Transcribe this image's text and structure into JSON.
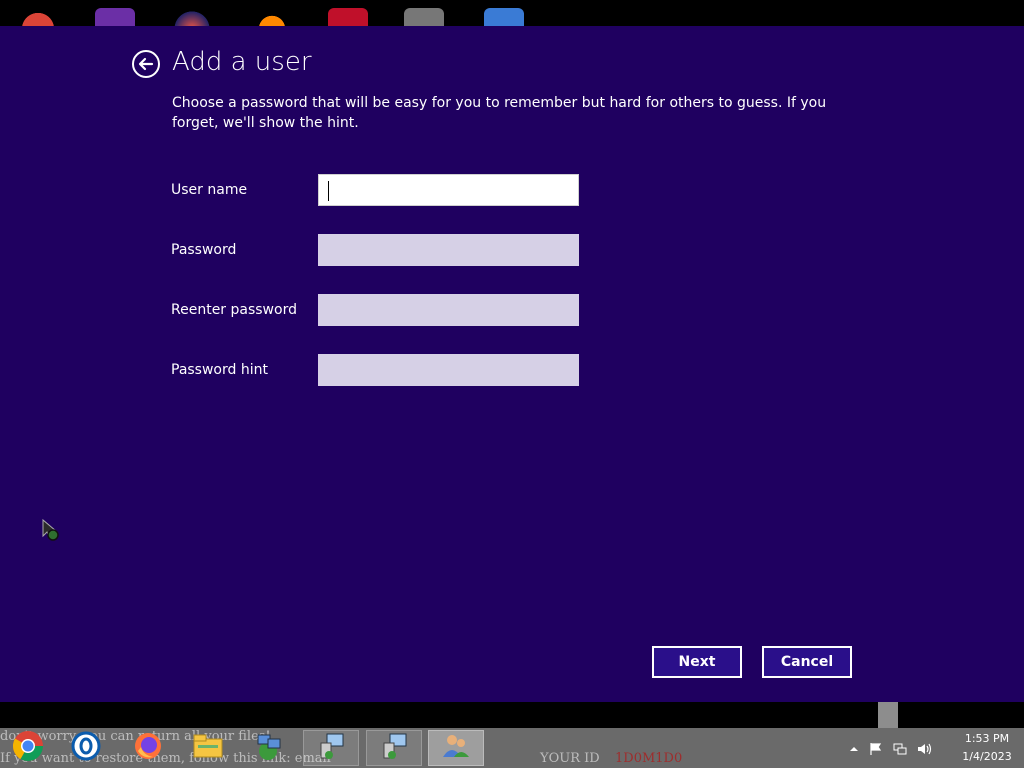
{
  "dialog": {
    "title": "Add a user",
    "subtitle": "Choose a password that will be easy for you to remember but hard for others to guess. If you forget, we'll show the hint.",
    "back_icon": "back-arrow-icon",
    "fields": [
      {
        "label": "User name",
        "value": "",
        "placeholder": "",
        "state": "focused"
      },
      {
        "label": "Password",
        "value": "",
        "placeholder": ""
      },
      {
        "label": "Reenter password",
        "value": "",
        "placeholder": ""
      },
      {
        "label": "Password hint",
        "value": "",
        "placeholder": ""
      }
    ],
    "next_label": "Next",
    "cancel_label": "Cancel"
  },
  "taskbar": {
    "pinned_icons": [
      "chrome-icon",
      "outlook-icon",
      "firefox-icon",
      "file-explorer-icon",
      "network-icon"
    ],
    "open_windows": [
      "network-setup-icon",
      "network-setup-icon",
      "user-accounts-icon"
    ],
    "tray_icons": [
      "show-hidden-icons",
      "action-center-flag-icon",
      "network-icon",
      "volume-icon"
    ],
    "clock_time": "1:53 PM",
    "clock_date": "1/4/2023"
  },
  "background_text": {
    "line1": "don't worry, you can return all your files!",
    "line2": "If you want to restore them, follow this link: email",
    "id_label": "YOUR ID",
    "id_value": "1D0M1D0"
  },
  "colors": {
    "dialog_bg": "#1f0060",
    "button_bg": "#2a0f8a",
    "input_inactive": "#d6d0e6",
    "taskbar_bg": "#6a6a6a"
  }
}
